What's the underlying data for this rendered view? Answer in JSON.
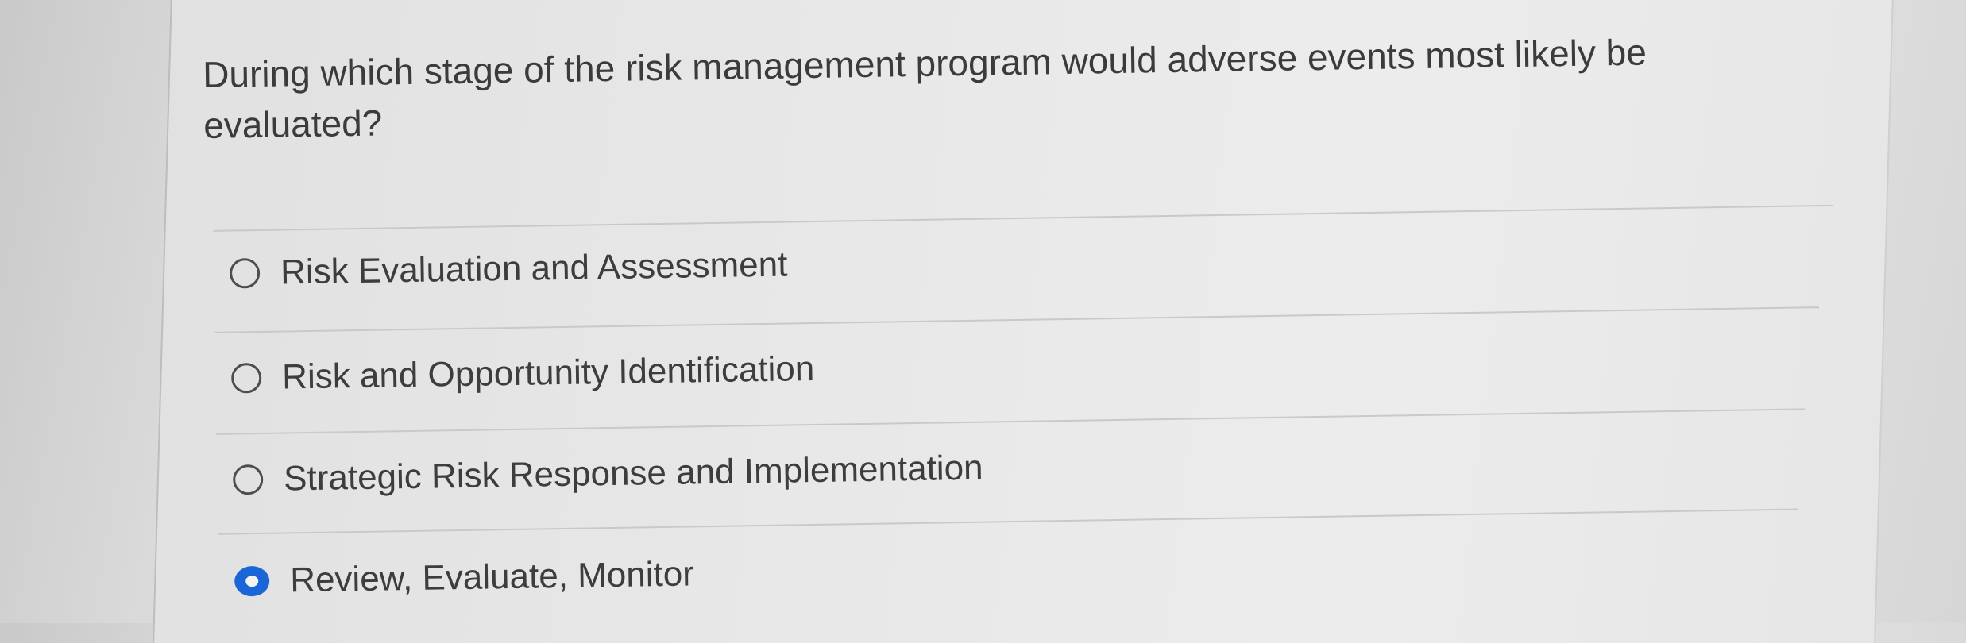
{
  "question": {
    "text": "During which stage of the risk management program would adverse events most likely be evaluated?"
  },
  "options": [
    {
      "label": "Risk Evaluation and Assessment",
      "selected": false
    },
    {
      "label": "Risk and Opportunity Identification",
      "selected": false
    },
    {
      "label": "Strategic Risk Response and Implementation",
      "selected": false
    },
    {
      "label": "Review, Evaluate, Monitor",
      "selected": true
    }
  ],
  "colors": {
    "selected_radio": "#1a66d6",
    "text": "#3b3b3b"
  }
}
